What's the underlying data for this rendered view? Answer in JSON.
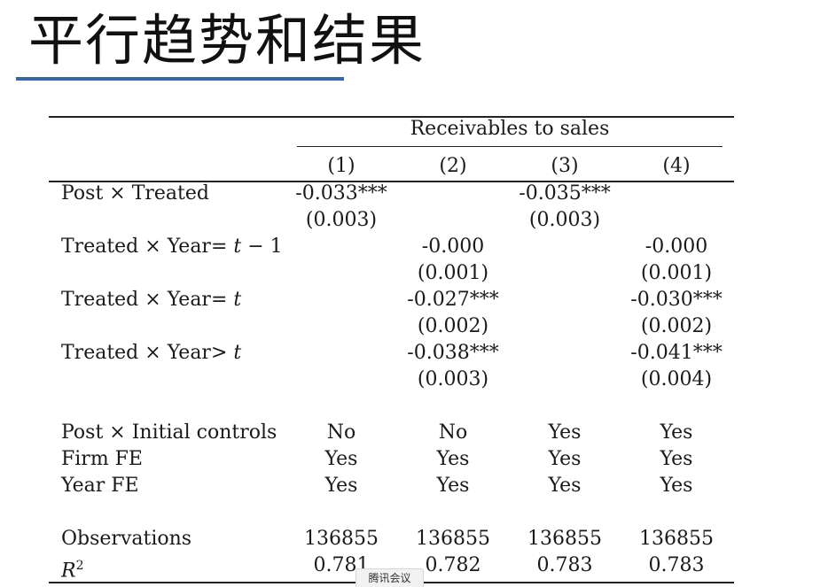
{
  "slide": {
    "title": "平行趋势和结果"
  },
  "table": {
    "group_header": "Receivables to sales",
    "columns": [
      "(1)",
      "(2)",
      "(3)",
      "(4)"
    ],
    "rows": [
      {
        "label": "Post × Treated",
        "cells": [
          "-0.033***",
          "",
          "-0.035***",
          ""
        ]
      },
      {
        "label": "",
        "cells": [
          "(0.003)",
          "",
          "(0.003)",
          ""
        ]
      },
      {
        "label": "Treated × Year= t − 1",
        "cells": [
          "",
          "-0.000",
          "",
          "-0.000"
        ]
      },
      {
        "label": "",
        "cells": [
          "",
          "(0.001)",
          "",
          "(0.001)"
        ]
      },
      {
        "label": "Treated × Year= t",
        "cells": [
          "",
          "-0.027***",
          "",
          "-0.030***"
        ]
      },
      {
        "label": "",
        "cells": [
          "",
          "(0.002)",
          "",
          "(0.002)"
        ]
      },
      {
        "label": "Treated × Year> t",
        "cells": [
          "",
          "-0.038***",
          "",
          "-0.041***"
        ]
      },
      {
        "label": "",
        "cells": [
          "",
          "(0.003)",
          "",
          "(0.004)"
        ]
      },
      {
        "label": "Post × Initial controls",
        "cells": [
          "No",
          "No",
          "Yes",
          "Yes"
        ]
      },
      {
        "label": "Firm FE",
        "cells": [
          "Yes",
          "Yes",
          "Yes",
          "Yes"
        ]
      },
      {
        "label": "Year FE",
        "cells": [
          "Yes",
          "Yes",
          "Yes",
          "Yes"
        ]
      },
      {
        "label": "Observations",
        "cells": [
          "136855",
          "136855",
          "136855",
          "136855"
        ]
      },
      {
        "label": "R2",
        "cells": [
          "0.781",
          "0.782",
          "0.783",
          "0.783"
        ]
      }
    ]
  },
  "overlay": {
    "badge_text": "腾讯会议"
  }
}
